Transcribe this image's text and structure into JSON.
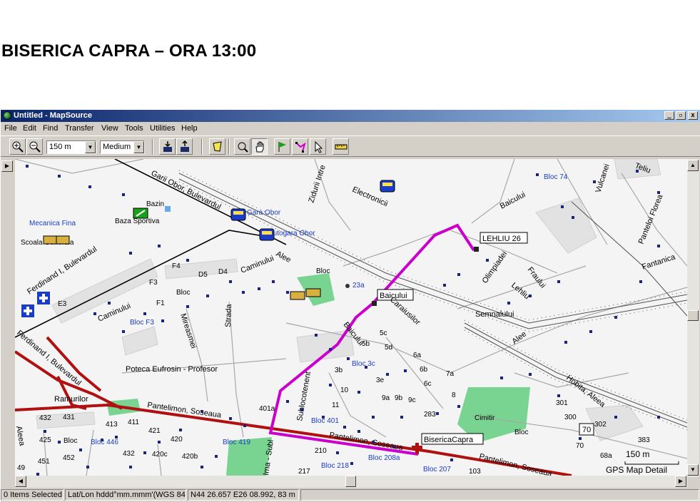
{
  "slide": {
    "title": "BISERICA CAPRA – ORA 13:00"
  },
  "window": {
    "title": "Untitled - MapSource",
    "controls": {
      "minimize": "_",
      "restore": "▫",
      "close": "x"
    }
  },
  "menu": [
    "File",
    "Edit",
    "Find",
    "Transfer",
    "View",
    "Tools",
    "Utilities",
    "Help"
  ],
  "toolbar": {
    "zoom_value": "150 m",
    "detail_value": "Medium"
  },
  "map": {
    "streets": [
      "Garii Obor, Bulevardul",
      "Ferdinand I, Bulevardul",
      "Electronicii",
      "Zidurii Intre",
      "Baicului",
      "Olimpiadei",
      "Fraului",
      "Lehliu",
      "Semnalului",
      "Fantanica",
      "Panteloi Florea",
      "Vulcanei",
      "Teliu",
      "Caminului",
      "Strada",
      "Mireasmei",
      "Poteca Eufrosin - Profesor",
      "Pantelimon, Soseaua",
      "Ramurilor",
      "Aleea",
      "Alee",
      "Hobita, Aleea",
      "Sublocotenent",
      "Caraiusilor",
      "Iancu",
      "Ima - Subl",
      "Pantelimon, Soseaua",
      "Pantelimon, Soseaua"
    ],
    "pois": [
      "Mecanica Fina",
      "Scoala Generala",
      "Bazin",
      "Baza Sportiva",
      "Gara Obor",
      "Autogara Obor",
      "Bloc 74",
      "Bloc",
      "23a",
      "Bloc F3",
      "Bloc 3c",
      "Bloc 401",
      "Bloc 419",
      "Bloc 446",
      "Bloc 218",
      "Bloc 208a",
      "Bloc 207",
      "Cimitir",
      "Bloc",
      "Bloc",
      "Bloc"
    ],
    "blocks": [
      "E3",
      "F1",
      "F3",
      "F4",
      "D5",
      "D4",
      "5c",
      "5b",
      "5d",
      "6a",
      "6b",
      "6c",
      "7a",
      "8",
      "3b",
      "3e",
      "10",
      "9a",
      "9b",
      "9c",
      "11",
      "401a",
      "283",
      "432",
      "431",
      "425",
      "413",
      "411",
      "421",
      "420",
      "432",
      "420c",
      "420b",
      "451",
      "452",
      "49",
      "210",
      "217",
      "103",
      "301",
      "300",
      "302",
      "70",
      "383",
      "68a"
    ],
    "waypoints": [
      {
        "label": "LEHLIU 26"
      },
      {
        "label": "Baicului"
      },
      {
        "label": "BisericaCapra"
      }
    ],
    "speed_sign": "70",
    "scale_label": "150 m",
    "detail_label": "GPS Map Detail"
  },
  "status": {
    "items": "0 Items Selected",
    "format": "Lat/Lon hddd°mm.mmm'(WGS 84)",
    "position": "N44 26.657 E26 08.992, 83 m"
  },
  "colors": {
    "route": "#cc00cc",
    "highway": "#b01010",
    "park": "#78d490",
    "poi": "#1a3ccc"
  }
}
